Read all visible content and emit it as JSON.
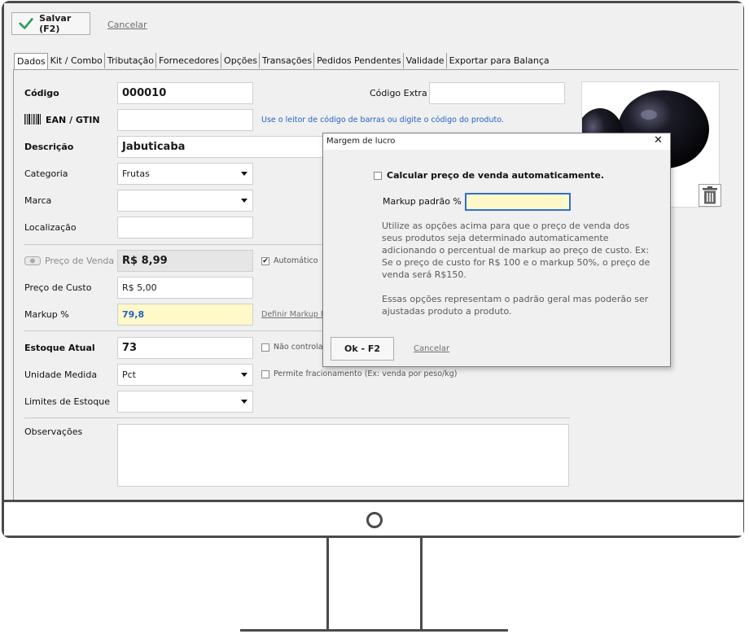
{
  "toolbar": {
    "save_label": "Salvar (F2)",
    "cancel_label": "Cancelar"
  },
  "tabs": [
    "Dados",
    "Kit / Combo",
    "Tributação",
    "Fornecedores",
    "Opções",
    "Transações",
    "Pedidos Pendentes",
    "Validade",
    "Exportar para Balança"
  ],
  "form": {
    "codigo": {
      "label": "Código",
      "value": "000010"
    },
    "codigo_extra": {
      "label": "Código Extra",
      "value": ""
    },
    "ean": {
      "label": "EAN / GTIN",
      "value": "",
      "hint": "Use o leitor de código de barras ou digite o código do produto."
    },
    "descricao": {
      "label": "Descrição",
      "value": "Jabuticaba"
    },
    "categoria": {
      "label": "Categoria",
      "value": "Frutas"
    },
    "marca": {
      "label": "Marca",
      "value": ""
    },
    "localizacao": {
      "label": "Localização",
      "value": ""
    },
    "preco_venda": {
      "label": "Preço de Venda",
      "value": "R$ 8,99",
      "automatic_label": "Automático",
      "automatic_checked": true
    },
    "preco_custo": {
      "label": "Preço de Custo",
      "value": "R$ 5,00"
    },
    "markup": {
      "label": "Markup %",
      "value": "79,8",
      "link": "Definir Markup P"
    },
    "estoque_atual": {
      "label": "Estoque Atual",
      "value": "73",
      "nao_controlar_label": "Não controla"
    },
    "unidade_medida": {
      "label": "Unidade Medida",
      "value": "Pct",
      "fracionamento_label": "Permite fracionamento (Ex: venda por peso/kg)"
    },
    "limites_estoque": {
      "label": "Limites de Estoque",
      "value": ""
    },
    "observacoes": {
      "label": "Observações",
      "value": ""
    }
  },
  "dialog": {
    "title": "Margem de lucro",
    "auto_calc_label": "Calcular preço de venda automaticamente.",
    "markup_label": "Markup padrão %",
    "markup_value": "",
    "description_1": "Utilize as opções acima para que o preço de venda dos seus produtos seja determinado automaticamente adicionando o percentual de markup ao preço de custo. Ex: Se o preço de custo for R$ 100 e o markup 50%, o preço de venda será R$150.",
    "description_2": "Essas opções representam o padrão geral mas poderão ser ajustadas produto a produto.",
    "ok_label": "Ok - F2",
    "cancel_label": "Cancelar"
  },
  "colors": {
    "accent_check": "#2e9e5b",
    "markup_field_bg": "#fff8c8",
    "hint_blue": "#1f62c9",
    "frame": "#4a4a4a"
  },
  "icons": [
    "check-icon",
    "barcode-icon",
    "eye-icon",
    "trash-icon",
    "close-icon",
    "chevron-down-icon"
  ]
}
